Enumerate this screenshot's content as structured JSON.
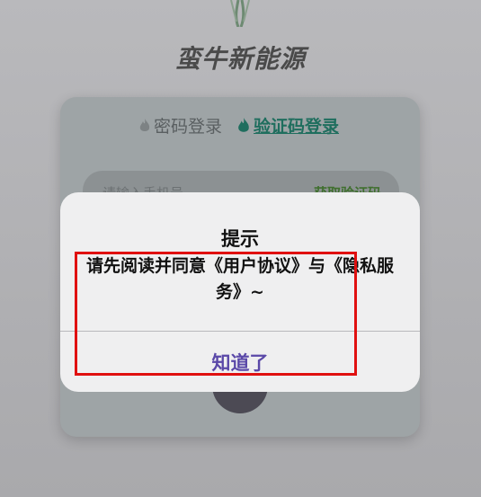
{
  "app": {
    "title": "蛮牛新能源"
  },
  "login": {
    "tabs": [
      {
        "label": "密码登录",
        "active": false
      },
      {
        "label": "验证码登录",
        "active": true
      }
    ],
    "code_input_placeholder": "请输入手机号",
    "get_code_label": "获取验证码"
  },
  "dialog": {
    "title": "提示",
    "message": "请先阅读并同意《用户协议》与《隐私服务》~",
    "ok_label": "知道了"
  },
  "colors": {
    "accent": "#1f6e5e",
    "dialog_button": "#5a48a8",
    "highlight": "#e01010"
  },
  "icons": [
    "leaf-logo-icon",
    "flame-icon"
  ]
}
